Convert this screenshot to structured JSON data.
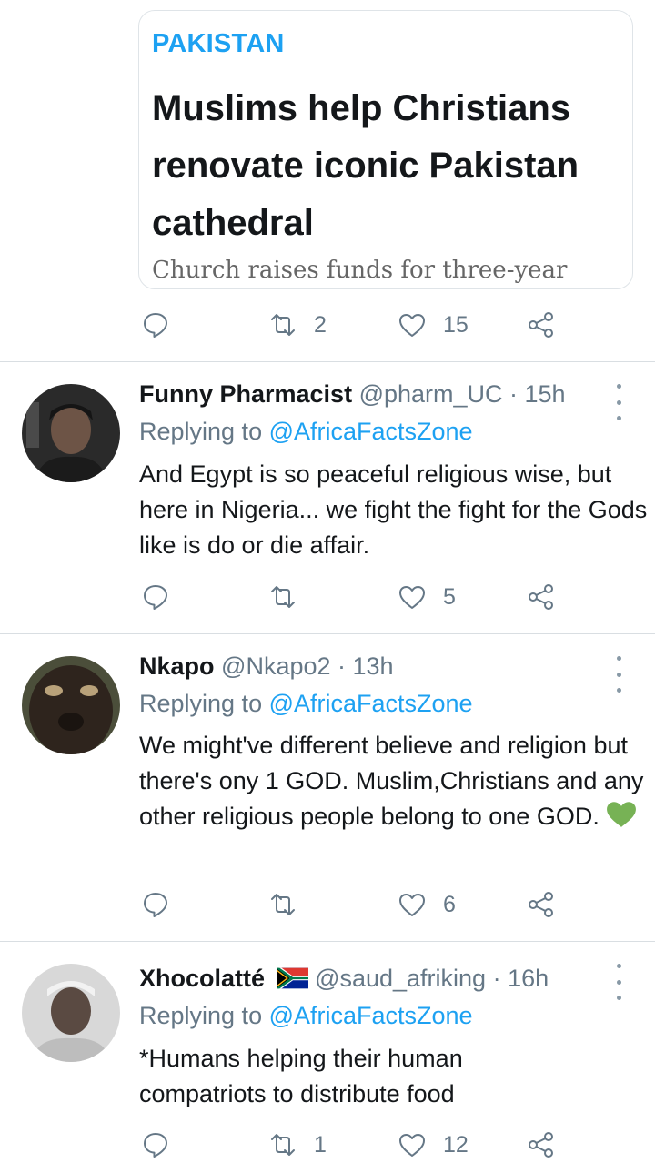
{
  "card": {
    "tag": "PAKISTAN",
    "title": "Muslims help Christians renovate iconic Pakistan cathedral",
    "subtitle": "Church raises funds for three-year",
    "retweets": "2",
    "likes": "15"
  },
  "replies": [
    {
      "name": "Funny Pharmacist",
      "handle": "@pharm_UC · 15h",
      "replying_prefix": "Replying to ",
      "replying_to": "@AfricaFactsZone",
      "text": "And Egypt is so peaceful religious wise, but here in Nigeria... we fight the fight for the Gods like is do or die affair.",
      "retweets": "",
      "likes": "5"
    },
    {
      "name": "Nkapo",
      "handle": "@Nkapo2 · 13h",
      "replying_prefix": "Replying to ",
      "replying_to": "@AfricaFactsZone",
      "text": "We might've different believe and religion but there's ony 1 GOD. Muslim,Christians and any other religious people belong to one GOD.",
      "retweets": "",
      "likes": "6"
    },
    {
      "name": "Xhocolatté",
      "handle": "@saud_afriking · 16h",
      "replying_prefix": "Replying to ",
      "replying_to": "@AfricaFactsZone",
      "text": "*Humans helping their human compatriots to distribute food",
      "retweets": "1",
      "likes": "12"
    }
  ],
  "colors": {
    "accent": "#1da1f2",
    "muted": "#657786",
    "heart_emoji": "#77b255"
  }
}
